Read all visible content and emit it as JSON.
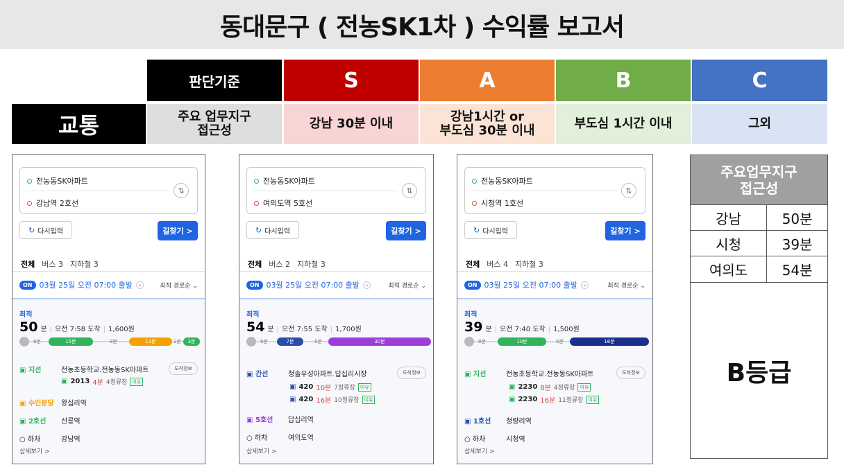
{
  "title": "동대문구 ( 전농SK1차 ) 수익률 보고서",
  "criteria": {
    "header_label": "판단기준",
    "grades": [
      {
        "grade": "S",
        "color": "#c00000",
        "cond_bg": "#f8d4d4",
        "condition_lines": [
          "강남 30분 이내"
        ]
      },
      {
        "grade": "A",
        "color": "#ed7d31",
        "cond_bg": "#fbe4d5",
        "condition_lines": [
          "강남1시간 or",
          "부도심 30분 이내"
        ]
      },
      {
        "grade": "B",
        "color": "#70ad47",
        "cond_bg": "#e2efda",
        "condition_lines": [
          "부도심 1시간 이내"
        ]
      },
      {
        "grade": "C",
        "color": "#4472c4",
        "cond_bg": "#dae3f3",
        "condition_lines": [
          "그외"
        ]
      }
    ],
    "category": "교통",
    "criterion_lines": [
      "주요 업무지구",
      "접근성"
    ]
  },
  "routes": [
    {
      "origin": "전농동SK아파트",
      "destination": "강남역 2호선",
      "reset_label": "다시입력",
      "search_label": "길찾기 >",
      "tabs": [
        "전체",
        "버스 3",
        "지하철 3"
      ],
      "on_badge": "ON",
      "depart": "03월 25일 오전 07:00 출발",
      "sort": "최적 경로순",
      "best_label": "최적",
      "duration": "50",
      "duration_unit": "분",
      "arrive": "오전 7:58 도착",
      "fare": "1,600원",
      "segments": [
        "8분",
        "15분",
        "8분",
        "11분",
        "2분",
        "3분"
      ],
      "steps": [
        {
          "label": "지선",
          "stop": "전농초등학교.전농동SK아파트",
          "arrival_badge": "도착정보",
          "buses": [
            {
              "num": "2013",
              "min": "4분",
              "rem": "4정류장",
              "tag": "여유"
            }
          ]
        },
        {
          "label": "수인분당",
          "stop": "왕십리역"
        },
        {
          "label": "2호선",
          "stop": "선릉역"
        },
        {
          "label": "하차",
          "stop": "강남역"
        }
      ],
      "more": "상세보기 >"
    },
    {
      "origin": "전농동SK아파트",
      "destination": "여의도역 5호선",
      "reset_label": "다시입력",
      "search_label": "길찾기 >",
      "tabs": [
        "전체",
        "버스 2",
        "지하철 3"
      ],
      "on_badge": "ON",
      "depart": "03월 25일 오전 07:00 출발",
      "sort": "최적 경로순",
      "best_label": "최적",
      "duration": "54",
      "duration_unit": "분",
      "arrive": "오전 7:55 도착",
      "fare": "1,700원",
      "segments": [
        "9분",
        "7분",
        "5분",
        "30분"
      ],
      "steps": [
        {
          "label": "간선",
          "stop": "청솔우성아파트.답십리시장",
          "arrival_badge": "도착정보",
          "buses": [
            {
              "num": "420",
              "min": "10분",
              "rem": "7정류장",
              "tag": "여유"
            },
            {
              "num": "420",
              "min": "16분",
              "rem": "10정류장",
              "tag": "여유"
            }
          ]
        },
        {
          "label": "5호선",
          "stop": "답십리역"
        },
        {
          "label": "하차",
          "stop": "여의도역"
        }
      ],
      "more": "상세보기 >"
    },
    {
      "origin": "전농동SK아파트",
      "destination": "시청역 1호선",
      "reset_label": "다시입력",
      "search_label": "길찾기 >",
      "tabs": [
        "전체",
        "버스 4",
        "지하철 3"
      ],
      "on_badge": "ON",
      "depart": "03월 25일 오전 07:00 출발",
      "sort": "최적 경로순",
      "best_label": "최적",
      "duration": "39",
      "duration_unit": "분",
      "arrive": "오전 7:40 도착",
      "fare": "1,500원",
      "segments": [
        "8분",
        "10분",
        "5분",
        "16분"
      ],
      "steps": [
        {
          "label": "지선",
          "stop": "전농초등학교.전농동SK아파트",
          "arrival_badge": "도착정보",
          "buses": [
            {
              "num": "2230",
              "min": "8분",
              "rem": "4정류장",
              "tag": "여유"
            },
            {
              "num": "2230",
              "min": "16분",
              "rem": "11정류장",
              "tag": "여유"
            }
          ]
        },
        {
          "label": "1호선",
          "stop": "청량리역"
        },
        {
          "label": "하차",
          "stop": "시청역"
        }
      ],
      "more": "상세보기 >"
    }
  ],
  "access_table": {
    "header_lines": [
      "주요업무지구",
      "접근성"
    ],
    "rows": [
      {
        "place": "강남",
        "time": "50분"
      },
      {
        "place": "시청",
        "time": "39분"
      },
      {
        "place": "여의도",
        "time": "54분"
      }
    ],
    "grade": "B등급"
  }
}
